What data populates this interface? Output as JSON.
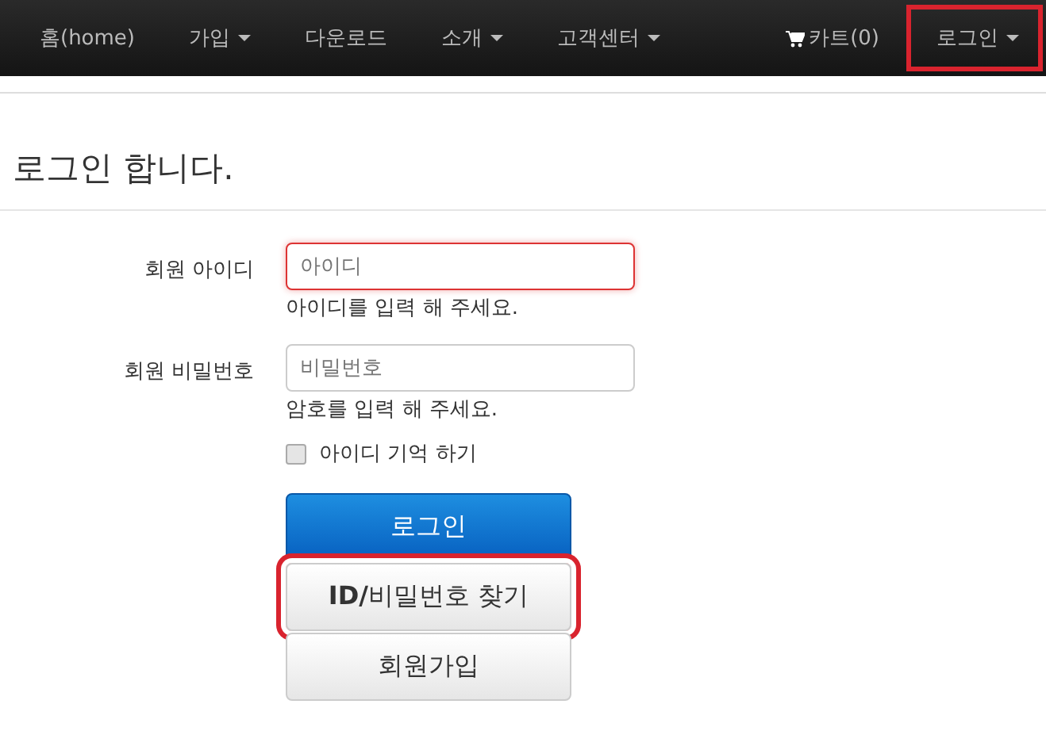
{
  "navbar": {
    "items": [
      {
        "label": "홈(home)",
        "dropdown": false,
        "highlighted": false
      },
      {
        "label": "가입",
        "dropdown": true,
        "highlighted": false
      },
      {
        "label": "다운로드",
        "dropdown": false,
        "highlighted": false
      },
      {
        "label": "소개",
        "dropdown": true,
        "highlighted": false
      },
      {
        "label": "고객센터",
        "dropdown": true,
        "highlighted": false
      }
    ],
    "right_items": [
      {
        "label": "카트(0)",
        "kind": "cart",
        "dropdown": false,
        "highlighted": false
      },
      {
        "label": "로그인",
        "kind": "text",
        "dropdown": true,
        "highlighted": true
      }
    ]
  },
  "heading": "로그인 합니다.",
  "form": {
    "fields": [
      {
        "label": "회원 아이디",
        "placeholder": "아이디",
        "help": "아이디를 입력 해 주세요.",
        "error": true
      },
      {
        "label": "회원 비밀번호",
        "placeholder": "비밀번호",
        "help": "암호를 입력 해 주세요.",
        "error": false
      }
    ],
    "remember": {
      "label": "아이디 기억 하기",
      "checked": false
    },
    "buttons": [
      {
        "label": "로그인",
        "kind": "primary",
        "highlighted": false
      },
      {
        "label": "**ID/**비밀번호 찾기",
        "kind": "default",
        "highlighted": true
      },
      {
        "label": "회원가입",
        "kind": "default",
        "highlighted": false
      }
    ]
  }
}
